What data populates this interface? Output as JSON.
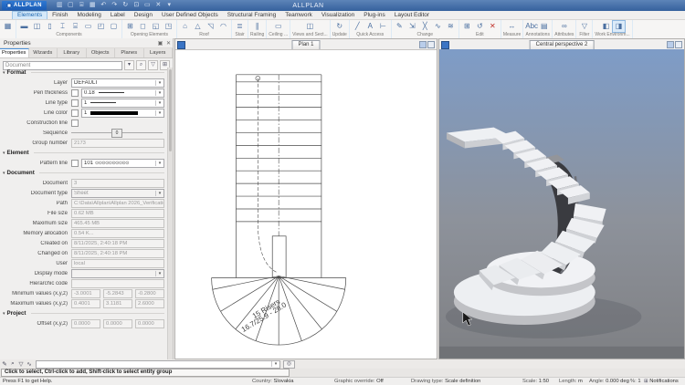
{
  "titlebar": {
    "logo_text": "ALLPLAN",
    "window_title": "ALLPLAN",
    "quick_access_icons": [
      "clipboard",
      "new-file",
      "open-file",
      "save-file",
      "undo",
      "redo",
      "refresh",
      "new-window",
      "layout",
      "close",
      "more"
    ]
  },
  "menu": {
    "tabs": [
      {
        "label": "Elements",
        "active": true
      },
      {
        "label": "Finish"
      },
      {
        "label": "Modeling"
      },
      {
        "label": "Label"
      },
      {
        "label": "Design"
      },
      {
        "label": "User Defined Objects"
      },
      {
        "label": "Structural Framing"
      },
      {
        "label": "Teamwork"
      },
      {
        "label": "Visualization"
      },
      {
        "label": "Plug-ins"
      },
      {
        "label": "Layout Editor"
      }
    ]
  },
  "ribbon": {
    "groups": [
      {
        "label": "",
        "icons": [
          "task-board"
        ]
      },
      {
        "label": "Components",
        "icons": [
          "wall",
          "wall-pillar",
          "column",
          "downstand-beam",
          "strip-foundation",
          "slab",
          "chimney",
          "room"
        ]
      },
      {
        "label": "Opening Elements",
        "icons": [
          "window",
          "door",
          "wall-opening",
          "recess"
        ]
      },
      {
        "label": "Roof",
        "icons": [
          "roof-plane",
          "roof-frame",
          "skylight",
          "roof-covering"
        ]
      },
      {
        "label": "Stair",
        "icons": [
          "stair"
        ]
      },
      {
        "label": "Railing",
        "icons": [
          "railing"
        ]
      },
      {
        "label": "Ceiling ...",
        "icons": [
          "ceiling"
        ]
      },
      {
        "label": "Views and Sect...",
        "icons": [
          "section-view"
        ]
      },
      {
        "label": "Update",
        "icons": [
          "update-3d"
        ]
      },
      {
        "label": "Quick Access",
        "icons": [
          "line",
          "text",
          "dimension-line"
        ]
      },
      {
        "label": "Change",
        "icons": [
          "edit-pencil",
          "offset",
          "trim",
          "wave",
          "match-properties"
        ]
      },
      {
        "label": "Edit",
        "icons": [
          "copy-element",
          "rotate",
          "delete"
        ]
      },
      {
        "label": "Measure",
        "icons": [
          "measure"
        ]
      },
      {
        "label": "Annotations",
        "icons": [
          "abc-text",
          "annotation-sheet"
        ]
      },
      {
        "label": "Attributes",
        "icons": [
          "attributes-glasses"
        ]
      },
      {
        "label": "Filter",
        "icons": [
          "filter-funnel"
        ]
      },
      {
        "label": "Work Environm...",
        "icons": [
          "plan-view",
          "isometric-view"
        ],
        "active_icon": 1
      }
    ]
  },
  "properties_panel": {
    "title": "Properties",
    "tabs": [
      {
        "label": "Properties",
        "active": true
      },
      {
        "label": "Wizards"
      },
      {
        "label": "Library"
      },
      {
        "label": "Objects"
      },
      {
        "label": "Planes"
      },
      {
        "label": "Layers"
      }
    ],
    "filter_value": "Document",
    "sections": [
      {
        "title": "Format",
        "rows": [
          {
            "type": "select",
            "label": "Layer",
            "value": "DEFAULT"
          },
          {
            "type": "check-select",
            "label": "Pen thickness",
            "value": "0.18",
            "preview": "line"
          },
          {
            "type": "check-select",
            "label": "Line type",
            "value": "1",
            "preview": "line"
          },
          {
            "type": "check-select",
            "label": "Line color",
            "value": "1",
            "preview": "swatch"
          },
          {
            "type": "check",
            "label": "Construction line"
          },
          {
            "type": "slider",
            "label": "Sequence",
            "value": "0"
          },
          {
            "type": "input",
            "label": "Group number",
            "value": "2173"
          }
        ]
      },
      {
        "title": "Element",
        "rows": [
          {
            "type": "check-select",
            "label": "Pattern line",
            "value": "101",
            "preview": "pattern"
          }
        ]
      },
      {
        "title": "Document",
        "rows": [
          {
            "type": "input",
            "label": "Document",
            "value": "3"
          },
          {
            "type": "select-disabled",
            "label": "Document type",
            "value": "Sheet"
          },
          {
            "type": "input",
            "label": "Path",
            "value": "C:\\Data\\Allplan\\Allplan 2026_Verification"
          },
          {
            "type": "input",
            "label": "File size",
            "value": "0.62 MB"
          },
          {
            "type": "input",
            "label": "Maximum size",
            "value": "465.45 MB"
          },
          {
            "type": "input",
            "label": "Memory allocation",
            "value": "0.54 K..."
          },
          {
            "type": "input",
            "label": "Created on",
            "value": "8/11/2025, 2:40:18 PM"
          },
          {
            "type": "input",
            "label": "Changed on",
            "value": "8/11/2025, 2:40:18 PM"
          },
          {
            "type": "input",
            "label": "User",
            "value": "local"
          },
          {
            "type": "select-disabled",
            "label": "Display mode",
            "value": ""
          },
          {
            "type": "input",
            "label": "Hierarchic code",
            "value": ""
          },
          {
            "type": "triple",
            "label": "Minimum values (x,y,z)",
            "values": [
              "-3.0001",
              "-5.2843",
              "-0.2800"
            ]
          },
          {
            "type": "triple",
            "label": "Maximum values (x,y,z)",
            "values": [
              "0.4001",
              "3.1181",
              "2.6000"
            ]
          }
        ]
      },
      {
        "title": "Project",
        "rows": [
          {
            "type": "triple",
            "label": "Offset (x,y,z)",
            "values": [
              "0.0000",
              "0.0000",
              "0.0000"
            ]
          }
        ]
      }
    ]
  },
  "plan_view": {
    "tab_label": "Plan 1",
    "stair_label_line1": "15 Risers",
    "stair_label_line2": "16.7/25.9 - 28.0"
  },
  "perspective_view": {
    "tab_label": "Central perspective 2"
  },
  "command_bar": {
    "icons": [
      "match",
      "pen",
      "pin",
      "wave"
    ],
    "dropdown_value": "",
    "extra_icon": "target",
    "prompt": "Click to select, Ctrl-click to add, Shift-click to select entity group"
  },
  "statusbar": {
    "help": "Press F1 to get Help.",
    "country_label": "Country:",
    "country_value": "Slovakia",
    "graphic_label": "Graphic override:",
    "graphic_value": "Off",
    "drawing_label": "Drawing type:",
    "drawing_value": "Scale definition",
    "scale_label": "Scale:",
    "scale_value": "1:50",
    "length_label": "Length:",
    "length_value": "m",
    "angle_label": "Angle:",
    "angle_value": "0.000 deg",
    "percent_label": "%:",
    "percent_value": "1",
    "notifications": "Notifications"
  },
  "colors": {
    "accent": "#2f6fb4",
    "selection": "#d6e9f9",
    "viewport_sky": "#7e9cc7",
    "wall_dark": "#3a3b40"
  }
}
